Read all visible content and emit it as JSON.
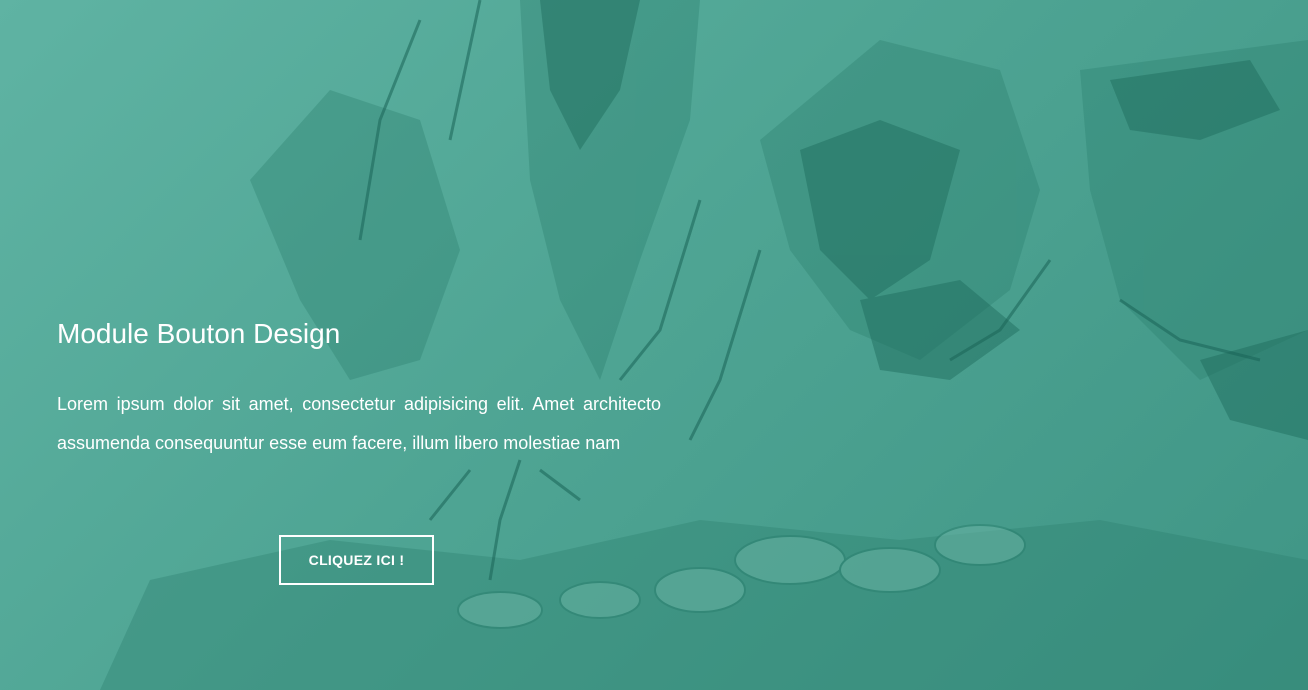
{
  "hero": {
    "title": "Module Bouton Design",
    "description": "Lorem ipsum dolor sit amet, consectetur adipisicing elit. Amet architecto assumenda consequuntur esse eum facere, illum libero molestiae nam",
    "button_label": "CLIQUEZ ICI !"
  },
  "colors": {
    "overlay": "#4fa594",
    "ink_dark": "#1f6f5f",
    "text": "#ffffff"
  }
}
